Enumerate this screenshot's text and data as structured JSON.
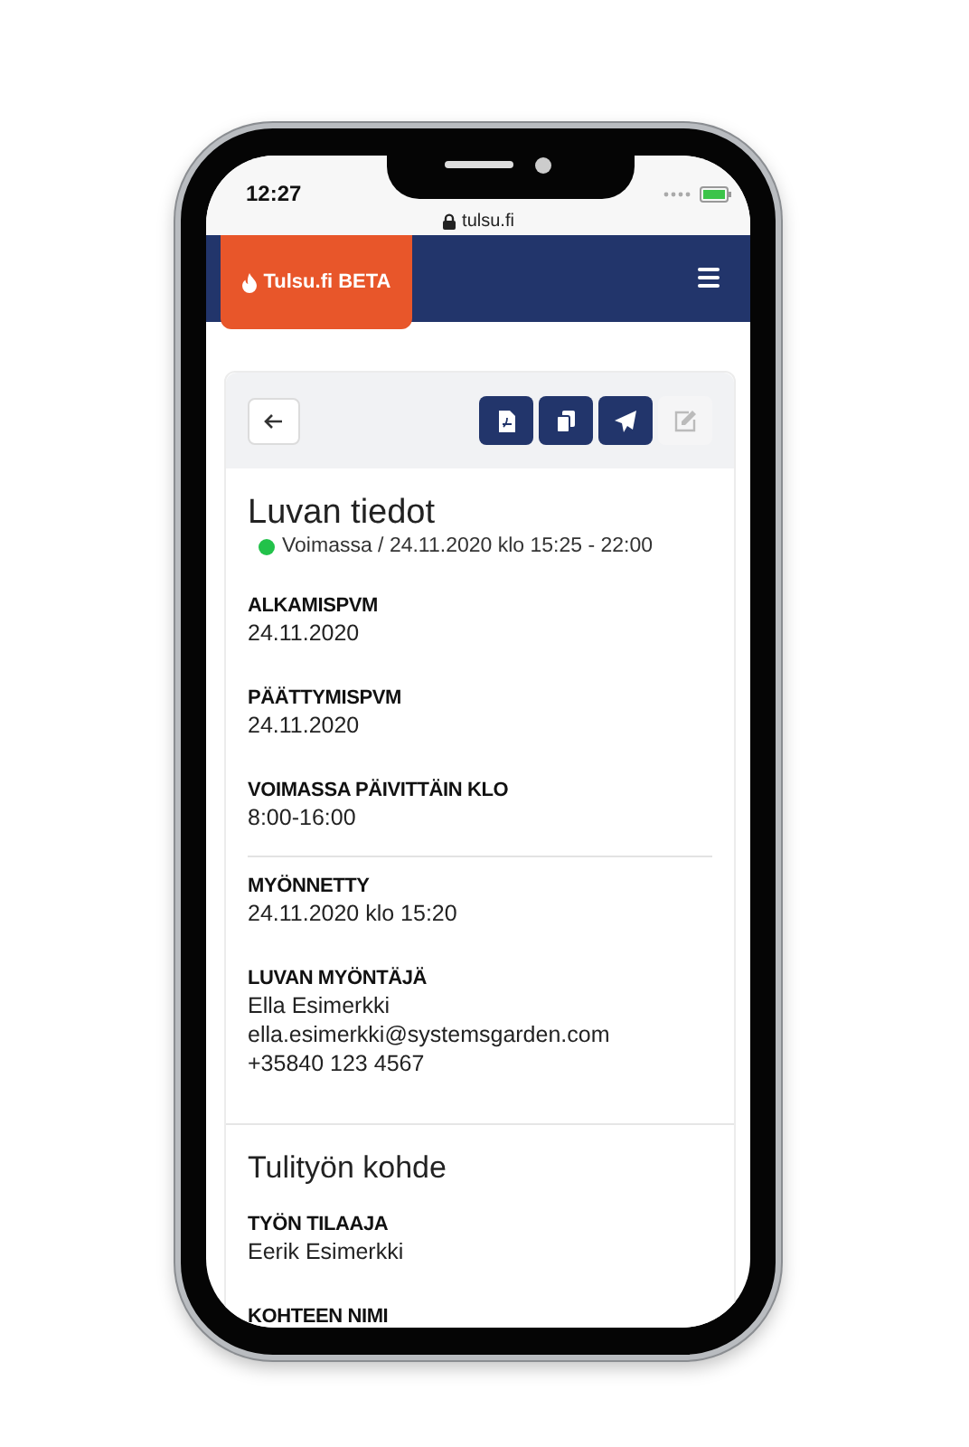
{
  "status_bar": {
    "time": "12:27"
  },
  "browser": {
    "url": "tulsu.fi"
  },
  "navbar": {
    "brand": "Tulsu.fi BETA"
  },
  "toolbar": {
    "buttons": [
      {
        "kind": "back"
      },
      {
        "kind": "pdf",
        "disabled": false
      },
      {
        "kind": "copy",
        "disabled": false
      },
      {
        "kind": "send",
        "disabled": false
      },
      {
        "kind": "edit",
        "disabled": true
      }
    ]
  },
  "sections": [
    {
      "title": "Luvan tiedot",
      "status": {
        "text": "Voimassa / 24.11.2020 klo 15:25 - 22:00",
        "color": "#22c24a"
      },
      "groups": [
        [
          {
            "label": "ALKAMISPVM",
            "lines": [
              "24.11.2020"
            ]
          },
          {
            "label": "PÄÄTTYMISPVM",
            "lines": [
              "24.11.2020"
            ]
          },
          {
            "label": "VOIMASSA PÄIVITTÄIN KLO",
            "lines": [
              "8:00-16:00"
            ]
          }
        ],
        [
          {
            "label": "MYÖNNETTY",
            "lines": [
              "24.11.2020 klo 15:20"
            ]
          },
          {
            "label": "LUVAN MYÖNTÄJÄ",
            "lines": [
              "Ella Esimerkki",
              "ella.esimerkki@systemsgarden.com",
              "+35840 123 4567"
            ]
          }
        ]
      ]
    },
    {
      "title": "Tulityön kohde",
      "groups": [
        [
          {
            "label": "TYÖN TILAAJA",
            "lines": [
              "Eerik Esimerkki"
            ]
          },
          {
            "label": "KOHTEEN NIMI"
          }
        ]
      ]
    }
  ]
}
